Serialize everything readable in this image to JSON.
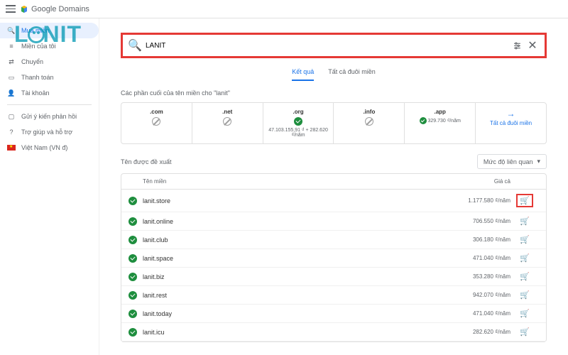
{
  "header": {
    "brand": "Google Domains"
  },
  "sidebar": {
    "items": [
      {
        "label": "Mua miền"
      },
      {
        "label": "Miền của tôi"
      },
      {
        "label": "Chuyển"
      },
      {
        "label": "Thanh toán"
      },
      {
        "label": "Tài khoản"
      }
    ],
    "footer": [
      {
        "label": "Gửi ý kiến phản hồi"
      },
      {
        "label": "Trợ giúp và hỗ trợ"
      },
      {
        "label": "Việt Nam (VN đ)"
      }
    ]
  },
  "search": {
    "value": "LANIT"
  },
  "tabs": {
    "results": "Kết quả",
    "all": "Tất cả đuôi miền"
  },
  "tld_section": {
    "title": "Các phần cuối của tên miền cho \"lanit\"",
    "items": [
      {
        "ext": ".com",
        "status": "unavail"
      },
      {
        "ext": ".net",
        "status": "unavail"
      },
      {
        "ext": ".org",
        "status": "avail",
        "price": "47.103.155,91 ₫ + 282.620 ₫/năm"
      },
      {
        "ext": ".info",
        "status": "unavail"
      },
      {
        "ext": ".app",
        "status": "avail_inline",
        "price": "329.730 ₫/năm"
      }
    ],
    "all_link": "Tất cả đuôi miền"
  },
  "suggestions": {
    "title": "Tên được đề xuất",
    "sort": "Mức độ liên quan",
    "th_name": "Tên miền",
    "th_price": "Giá cả",
    "rows": [
      {
        "name": "lanit.store",
        "price": "1.177.580 ₫/năm",
        "highlight_cart": true
      },
      {
        "name": "lanit.online",
        "price": "706.550 ₫/năm"
      },
      {
        "name": "lanit.club",
        "price": "306.180 ₫/năm"
      },
      {
        "name": "lanit.space",
        "price": "471.040 ₫/năm"
      },
      {
        "name": "lanit.biz",
        "price": "353.280 ₫/năm"
      },
      {
        "name": "lanit.rest",
        "price": "942.070 ₫/năm"
      },
      {
        "name": "lanit.today",
        "price": "471.040 ₫/năm"
      },
      {
        "name": "lanit.icu",
        "price": "282.620 ₫/năm"
      }
    ]
  },
  "watermark": {
    "pre": "L",
    "post": "NIT"
  }
}
